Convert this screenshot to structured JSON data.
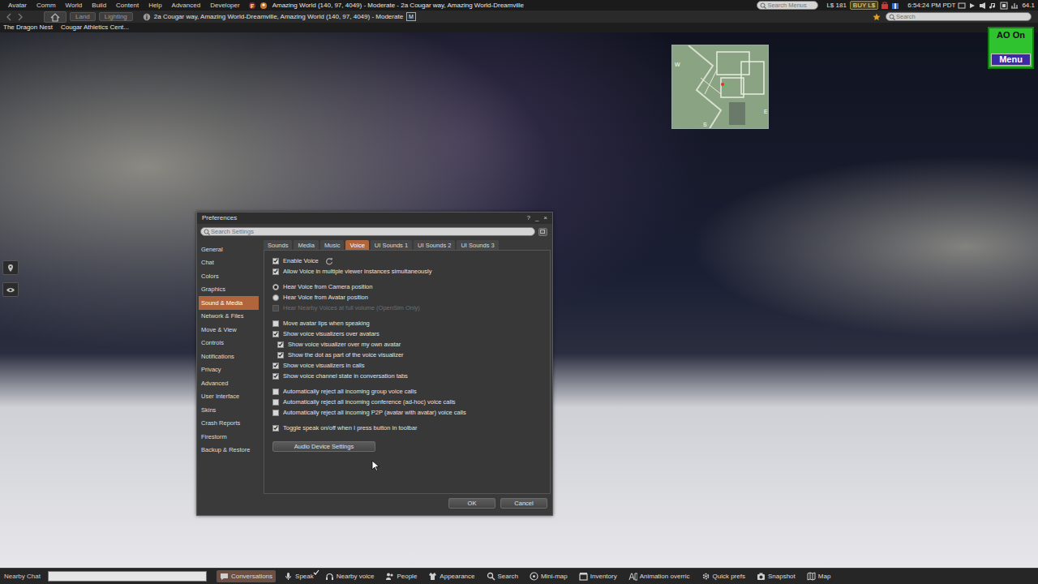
{
  "menu_bar": {
    "items": [
      "Avatar",
      "Comm",
      "World",
      "Build",
      "Content",
      "Help",
      "Advanced",
      "Developer"
    ],
    "location": "Amazing World (140, 97, 4049) - Moderate - 2a Cougar way, Amazing World-Dreamville",
    "search_placeholder": "Search Menus",
    "balance": "L$ 181",
    "buy": "BUY L$",
    "time": "6:54:24 PM PDT",
    "fps": "64.1"
  },
  "nav_bar": {
    "buttons": [
      "Land",
      "Lighting"
    ],
    "address": "2a Cougar way, Amazing World-Dreamville, Amazing World (140, 97, 4049) - Moderate",
    "maturity": "M",
    "search_placeholder": "Search"
  },
  "favorites": [
    "The Dragon Nest",
    "Cougar Athletics Cent..."
  ],
  "minimap": {
    "west": "W",
    "east": "E",
    "south": "S"
  },
  "hud": {
    "status": "AO On",
    "menu": "Menu"
  },
  "preferences": {
    "title": "Preferences",
    "title_buttons": [
      "?",
      "_",
      "×"
    ],
    "search_placeholder": "Search Settings",
    "categories": [
      {
        "label": "General",
        "selected": false
      },
      {
        "label": "Chat",
        "selected": false
      },
      {
        "label": "Colors",
        "selected": false
      },
      {
        "label": "Graphics",
        "selected": false
      },
      {
        "label": "Sound & Media",
        "selected": true
      },
      {
        "label": "Network & Files",
        "selected": false
      },
      {
        "label": "Move & View",
        "selected": false
      },
      {
        "label": "Controls",
        "selected": false
      },
      {
        "label": "Notifications",
        "selected": false
      },
      {
        "label": "Privacy",
        "selected": false
      },
      {
        "label": "Advanced",
        "selected": false
      },
      {
        "label": "User Interface",
        "selected": false
      },
      {
        "label": "Skins",
        "selected": false
      },
      {
        "label": "Crash Reports",
        "selected": false
      },
      {
        "label": "Firestorm",
        "selected": false
      },
      {
        "label": "Backup & Restore",
        "selected": false
      }
    ],
    "tabs": [
      {
        "label": "Sounds",
        "selected": false
      },
      {
        "label": "Media",
        "selected": false
      },
      {
        "label": "Music",
        "selected": false
      },
      {
        "label": "Voice",
        "selected": true
      },
      {
        "label": "UI Sounds 1",
        "selected": false
      },
      {
        "label": "UI Sounds 2",
        "selected": false
      },
      {
        "label": "UI Sounds 3",
        "selected": false
      }
    ],
    "settings_groups": [
      [
        {
          "kind": "checkbox",
          "label": "Enable Voice",
          "checked": true,
          "disabled": false
        },
        {
          "kind": "checkbox",
          "label": "Allow Voice in multiple viewer instances simultaneously",
          "checked": true,
          "disabled": false
        }
      ],
      [
        {
          "kind": "radio",
          "label": "Hear Voice from Camera position",
          "selected": true,
          "disabled": false
        },
        {
          "kind": "radio",
          "label": "Hear Voice from Avatar position",
          "selected": false,
          "disabled": false
        },
        {
          "kind": "checkbox",
          "label": "Hear Nearby Voices at full volume (OpenSim Only)",
          "checked": false,
          "disabled": true
        }
      ],
      [
        {
          "kind": "checkbox",
          "label": "Move avatar lips when speaking",
          "checked": false,
          "disabled": false
        },
        {
          "kind": "checkbox",
          "label": "Show voice visualizers over avatars",
          "checked": true,
          "disabled": false,
          "children": [
            {
              "kind": "checkbox",
              "label": "Show voice visualizer over my own avatar",
              "checked": true,
              "disabled": false
            },
            {
              "kind": "checkbox",
              "label": "Show the dot as part of the voice visualizer",
              "checked": true,
              "disabled": false
            }
          ]
        },
        {
          "kind": "checkbox",
          "label": "Show voice visualizers in calls",
          "checked": true,
          "disabled": false
        },
        {
          "kind": "checkbox",
          "label": "Show voice channel state in conversation tabs",
          "checked": true,
          "disabled": false
        }
      ],
      [
        {
          "kind": "checkbox",
          "label": "Automatically reject all incoming group voice calls",
          "checked": false,
          "disabled": false
        },
        {
          "kind": "checkbox",
          "label": "Automatically reject all incoming conference (ad-hoc) voice calls",
          "checked": false,
          "disabled": false
        },
        {
          "kind": "checkbox",
          "label": "Automatically reject all incoming P2P (avatar with avatar) voice calls",
          "checked": false,
          "disabled": false
        }
      ],
      [
        {
          "kind": "checkbox",
          "label": "Toggle speak on/off when I press button in toolbar",
          "checked": true,
          "disabled": false
        }
      ]
    ],
    "device_button": "Audio Device Settings",
    "buttons": [
      "OK",
      "Cancel"
    ]
  },
  "toolbar": {
    "chat_label": "Nearby Chat",
    "buttons": [
      {
        "label": "Conversations",
        "selected": true,
        "checked": false
      },
      {
        "label": "Speak",
        "selected": false,
        "checked": true
      },
      {
        "label": "Nearby voice",
        "selected": false,
        "checked": false
      },
      {
        "label": "People",
        "selected": false,
        "checked": false
      },
      {
        "label": "Appearance",
        "selected": false,
        "checked": false
      },
      {
        "label": "Search",
        "selected": false,
        "checked": false
      },
      {
        "label": "Mini-map",
        "selected": false,
        "checked": false
      },
      {
        "label": "Inventory",
        "selected": false,
        "checked": false
      },
      {
        "label": "Animation overric",
        "selected": false,
        "checked": false
      },
      {
        "label": "Quick prefs",
        "selected": false,
        "checked": false
      },
      {
        "label": "Snapshot",
        "selected": false,
        "checked": false
      },
      {
        "label": "Map",
        "selected": false,
        "checked": false
      }
    ]
  }
}
